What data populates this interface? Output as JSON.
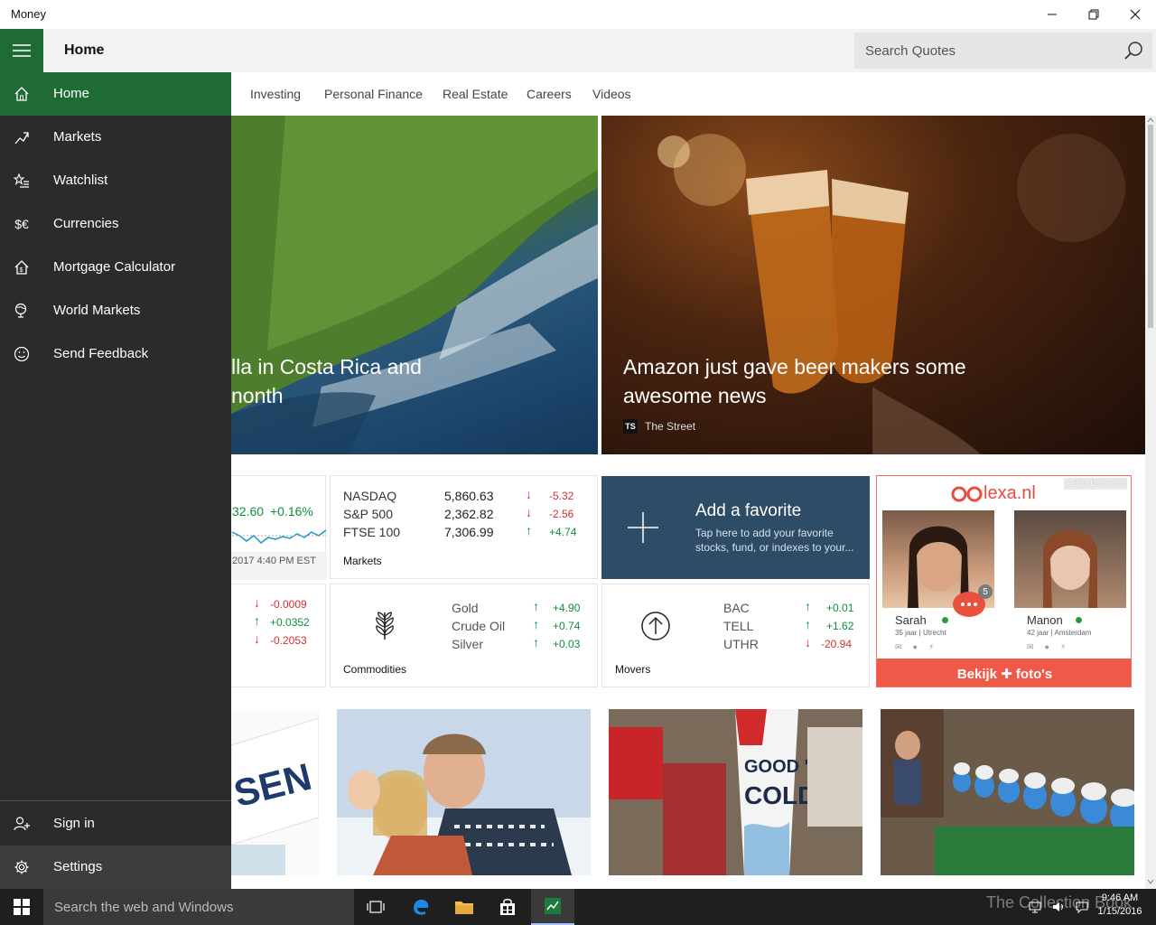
{
  "window": {
    "title": "Money"
  },
  "appbar": {
    "page_title": "Home",
    "search_placeholder": "Search Quotes"
  },
  "nav": {
    "items": [
      {
        "label": "Home",
        "icon": "home-icon"
      },
      {
        "label": "Markets",
        "icon": "trend-icon"
      },
      {
        "label": "Watchlist",
        "icon": "watchlist-icon"
      },
      {
        "label": "Currencies",
        "icon": "currency-icon"
      },
      {
        "label": "Mortgage Calculator",
        "icon": "mortgage-icon"
      },
      {
        "label": "World Markets",
        "icon": "globe-icon"
      },
      {
        "label": "Send Feedback",
        "icon": "smiley-icon"
      }
    ],
    "bottom": [
      {
        "label": "Sign in",
        "icon": "add-user-icon"
      },
      {
        "label": "Settings",
        "icon": "gear-icon"
      }
    ],
    "colors": {
      "active": "#1e6b35",
      "background": "#2b2b2b"
    }
  },
  "tabs": [
    "Investing",
    "Personal Finance",
    "Real Estate",
    "Careers",
    "Videos"
  ],
  "hero": {
    "left": {
      "title_line1": "lla in Costa Rica and",
      "title_line2": "nonth"
    },
    "right": {
      "title_line1": "Amazon just gave beer makers some",
      "title_line2": "awesome news",
      "source": "The Street",
      "source_logo": "TS"
    }
  },
  "index_card": {
    "value": "32.60",
    "change": "+0.16%",
    "time": "2017 4:40 PM EST"
  },
  "markets_card": {
    "label": "Markets",
    "rows": [
      {
        "name": "NASDAQ",
        "value": "5,860.63",
        "change": "-5.32",
        "dir": "down"
      },
      {
        "name": "S&P 500",
        "value": "2,362.82",
        "change": "-2.56",
        "dir": "down"
      },
      {
        "name": "FTSE 100",
        "value": "7,306.99",
        "change": "+4.74",
        "dir": "up"
      }
    ]
  },
  "favorite_card": {
    "title": "Add a favorite",
    "desc_line1": "Tap here to add your favorite",
    "desc_line2": "stocks, fund, or indexes to your..."
  },
  "currency_card": {
    "rows": [
      {
        "change": "-0.0009",
        "dir": "down"
      },
      {
        "change": "+0.0352",
        "dir": "up"
      },
      {
        "change": "-0.2053",
        "dir": "down"
      }
    ]
  },
  "commodities_card": {
    "label": "Commodities",
    "rows": [
      {
        "name": "Gold",
        "change": "+4.90",
        "dir": "up"
      },
      {
        "name": "Crude Oil",
        "change": "+0.74",
        "dir": "up"
      },
      {
        "name": "Silver",
        "change": "+0.03",
        "dir": "up"
      }
    ]
  },
  "movers_card": {
    "label": "Movers",
    "rows": [
      {
        "name": "BAC",
        "change": "+0.01",
        "dir": "up"
      },
      {
        "name": "TELL",
        "change": "+1.62",
        "dir": "up"
      },
      {
        "name": "UTHR",
        "change": "-20.94",
        "dir": "down"
      }
    ]
  },
  "ad": {
    "tag": "Advertisement",
    "brand": "lexa.nl",
    "person1": {
      "name": "Sarah",
      "info": "35 jaar | Utrecht"
    },
    "person2": {
      "name": "Manon",
      "info": "42 jaar | Amsterdam"
    },
    "bubble_count": "5",
    "cta": "Bekijk ✚ foto's"
  },
  "taskbar": {
    "search_placeholder": "Search the web and Windows",
    "time": "9:46 AM",
    "date": "1/15/2016",
    "watermark": "The Collection Book"
  }
}
